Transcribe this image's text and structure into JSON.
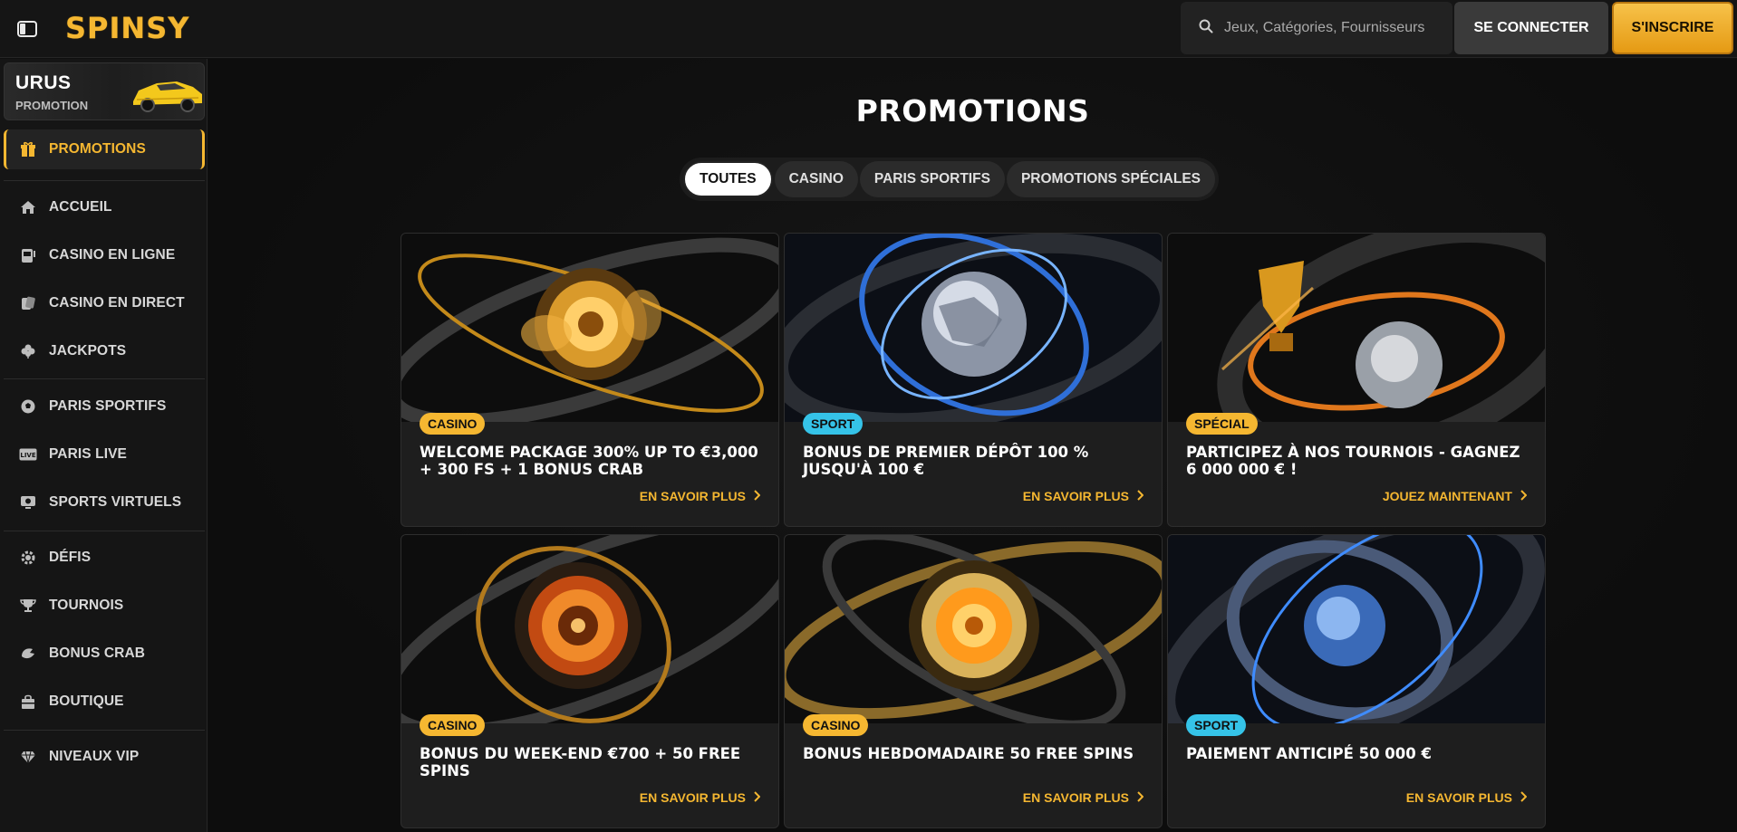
{
  "header": {
    "logo": "SPINSY",
    "search_placeholder": "Jeux, Catégories, Fournisseurs",
    "login_label": "SE CONNECTER",
    "register_label": "S'INSCRIRE"
  },
  "sidebar": {
    "promo_banner": {
      "title": "URUS",
      "subtitle": "PROMOTION"
    },
    "items": [
      {
        "label": "PROMOTIONS",
        "icon": "gift-icon",
        "active": true
      },
      {
        "label": "ACCUEIL",
        "icon": "home-icon"
      },
      {
        "label": "CASINO EN LIGNE",
        "icon": "slot-machine-icon"
      },
      {
        "label": "CASINO EN DIRECT",
        "icon": "cards-icon"
      },
      {
        "label": "JACKPOTS",
        "icon": "clover-icon"
      },
      {
        "label": "PARIS SPORTIFS",
        "icon": "soccer-ball-icon"
      },
      {
        "label": "PARIS LIVE",
        "icon": "live-icon"
      },
      {
        "label": "SPORTS VIRTUELS",
        "icon": "monitor-icon"
      },
      {
        "label": "DÉFIS",
        "icon": "gear-badge-icon"
      },
      {
        "label": "TOURNOIS",
        "icon": "trophy-icon"
      },
      {
        "label": "BONUS CRAB",
        "icon": "crab-claw-icon"
      },
      {
        "label": "BOUTIQUE",
        "icon": "shop-icon"
      },
      {
        "label": "NIVEAUX VIP",
        "icon": "diamond-icon"
      }
    ]
  },
  "main": {
    "title": "PROMOTIONS",
    "tabs": [
      {
        "label": "TOUTES",
        "active": true
      },
      {
        "label": "CASINO"
      },
      {
        "label": "PARIS SPORTIFS"
      },
      {
        "label": "PROMOTIONS SPÉCIALES"
      }
    ],
    "cards": [
      {
        "badge": "CASINO",
        "badge_type": "casino",
        "title": "WELCOME PACKAGE 300% UP TO €3,000 + 300 FS + 1 BONUS CRAB",
        "cta": "EN SAVOIR PLUS"
      },
      {
        "badge": "SPORT",
        "badge_type": "sport",
        "title": "BONUS DE PREMIER DÉPÔT 100 % JUSQU'À 100 €",
        "cta": "EN SAVOIR PLUS"
      },
      {
        "badge": "SPÉCIAL",
        "badge_type": "special",
        "title": "PARTICIPEZ À NOS TOURNOIS - GAGNEZ 6 000 000 € !",
        "cta": "JOUEZ MAINTENANT"
      },
      {
        "badge": "CASINO",
        "badge_type": "casino",
        "title": "BONUS DU WEEK-END €700 + 50 FREE SPINS",
        "cta": "EN SAVOIR PLUS"
      },
      {
        "badge": "CASINO",
        "badge_type": "casino",
        "title": "BONUS HEBDOMADAIRE 50 FREE SPINS",
        "cta": "EN SAVOIR PLUS"
      },
      {
        "badge": "SPORT",
        "badge_type": "sport",
        "title": "PAIEMENT ANTICIPÉ 50 000 €",
        "cta": "EN SAVOIR PLUS"
      }
    ]
  },
  "colors": {
    "accent": "#f5b731",
    "sport": "#35c3e8",
    "background": "#0f0f0f"
  }
}
